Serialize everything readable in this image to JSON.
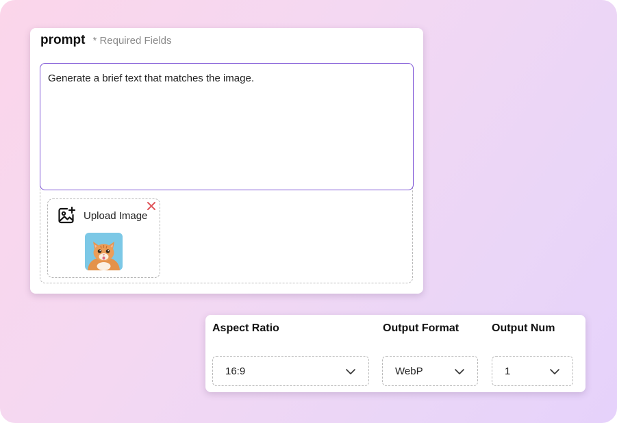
{
  "prompt": {
    "title": "prompt",
    "required_note": "* Required Fields",
    "text": "Generate a brief text that matches the image.",
    "upload_label": "Upload Image",
    "upload_icon": "image-add-icon",
    "remove_icon": "close-icon"
  },
  "settings": {
    "aspect_ratio": {
      "label": "Aspect Ratio",
      "value": "16:9"
    },
    "output_format": {
      "label": "Output Format",
      "value": "WebP"
    },
    "output_num": {
      "label": "Output Num",
      "value": "1"
    }
  },
  "colors": {
    "accent": "#7c52d6",
    "remove": "#e0565b"
  }
}
